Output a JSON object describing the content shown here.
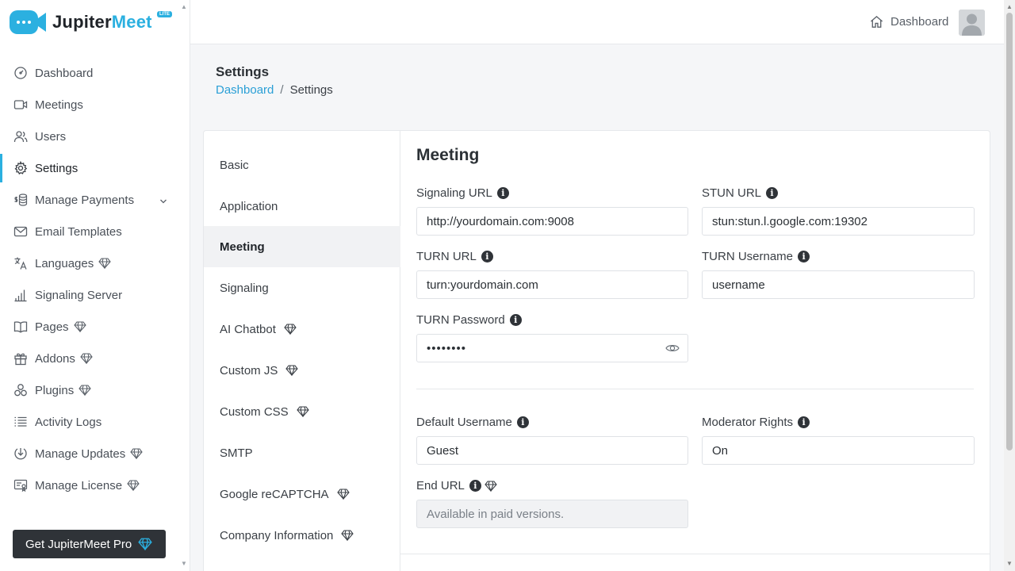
{
  "app": {
    "logo_text_1": "Jupiter",
    "logo_text_2": "Meet",
    "logo_badge": "LITE",
    "brand_color": "#2bb0e0"
  },
  "sidebar": {
    "items": [
      {
        "label": "Dashboard",
        "icon": "dashboard-icon"
      },
      {
        "label": "Meetings",
        "icon": "video-icon"
      },
      {
        "label": "Users",
        "icon": "users-icon"
      },
      {
        "label": "Settings",
        "icon": "gear-icon",
        "active": true
      },
      {
        "label": "Manage Payments",
        "icon": "coins-icon",
        "expandable": true
      },
      {
        "label": "Email Templates",
        "icon": "mail-icon"
      },
      {
        "label": "Languages",
        "icon": "translate-icon",
        "pro": true
      },
      {
        "label": "Signaling Server",
        "icon": "signal-icon"
      },
      {
        "label": "Pages",
        "icon": "book-icon",
        "pro": true
      },
      {
        "label": "Addons",
        "icon": "gift-icon",
        "pro": true
      },
      {
        "label": "Plugins",
        "icon": "plugins-icon",
        "pro": true
      },
      {
        "label": "Activity Logs",
        "icon": "list-icon"
      },
      {
        "label": "Manage Updates",
        "icon": "download-icon",
        "pro": true
      },
      {
        "label": "Manage License",
        "icon": "license-icon",
        "pro": true
      }
    ],
    "pro_button": "Get JupiterMeet Pro"
  },
  "topbar": {
    "dashboard_label": "Dashboard"
  },
  "page": {
    "title": "Settings",
    "breadcrumb_home": "Dashboard",
    "breadcrumb_sep": "/",
    "breadcrumb_current": "Settings"
  },
  "settings_nav": {
    "items": [
      {
        "label": "Basic"
      },
      {
        "label": "Application"
      },
      {
        "label": "Meeting",
        "active": true
      },
      {
        "label": "Signaling"
      },
      {
        "label": "AI Chatbot",
        "pro": true
      },
      {
        "label": "Custom JS",
        "pro": true
      },
      {
        "label": "Custom CSS",
        "pro": true
      },
      {
        "label": "SMTP"
      },
      {
        "label": "Google reCAPTCHA",
        "pro": true
      },
      {
        "label": "Company Information",
        "pro": true
      }
    ]
  },
  "meeting": {
    "title": "Meeting",
    "signaling_url": {
      "label": "Signaling URL",
      "value": "http://yourdomain.com:9008"
    },
    "stun_url": {
      "label": "STUN URL",
      "value": "stun:stun.l.google.com:19302"
    },
    "turn_url": {
      "label": "TURN URL",
      "value": "turn:yourdomain.com"
    },
    "turn_username": {
      "label": "TURN Username",
      "value": "username"
    },
    "turn_password": {
      "label": "TURN Password",
      "value": "••••••••"
    },
    "default_username": {
      "label": "Default Username",
      "value": "Guest"
    },
    "moderator_rights": {
      "label": "Moderator Rights",
      "value": "On"
    },
    "end_url": {
      "label": "End URL",
      "placeholder": "Available in paid versions."
    }
  }
}
